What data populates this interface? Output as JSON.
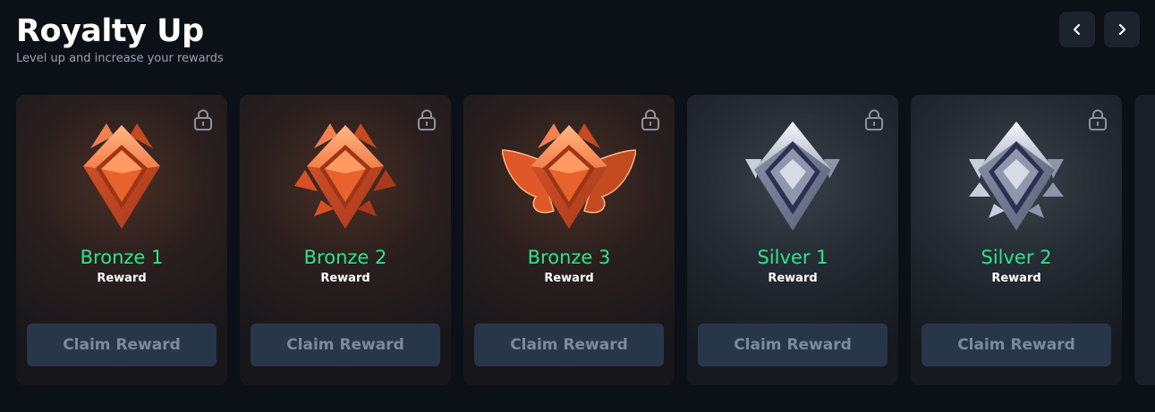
{
  "header": {
    "title": "Royalty Up",
    "subtitle": "Level up and increase your rewards",
    "prev_icon": "chevron-left-icon",
    "next_icon": "chevron-right-icon"
  },
  "colors": {
    "tier_name": "#2ee58a",
    "claim_button_bg": "#28364a",
    "claim_button_text": "#7d8a9d"
  },
  "cards": [
    {
      "tier": "Bronze 1",
      "reward_label": "Reward",
      "button": "Claim Reward",
      "locked": true,
      "icon": "bronze-1-rank-icon"
    },
    {
      "tier": "Bronze 2",
      "reward_label": "Reward",
      "button": "Claim Reward",
      "locked": true,
      "icon": "bronze-2-rank-icon"
    },
    {
      "tier": "Bronze 3",
      "reward_label": "Reward",
      "button": "Claim Reward",
      "locked": true,
      "icon": "bronze-3-rank-icon"
    },
    {
      "tier": "Silver 1",
      "reward_label": "Reward",
      "button": "Claim Reward",
      "locked": true,
      "icon": "silver-1-rank-icon"
    },
    {
      "tier": "Silver 2",
      "reward_label": "Reward",
      "button": "Claim Reward",
      "locked": true,
      "icon": "silver-2-rank-icon"
    }
  ]
}
